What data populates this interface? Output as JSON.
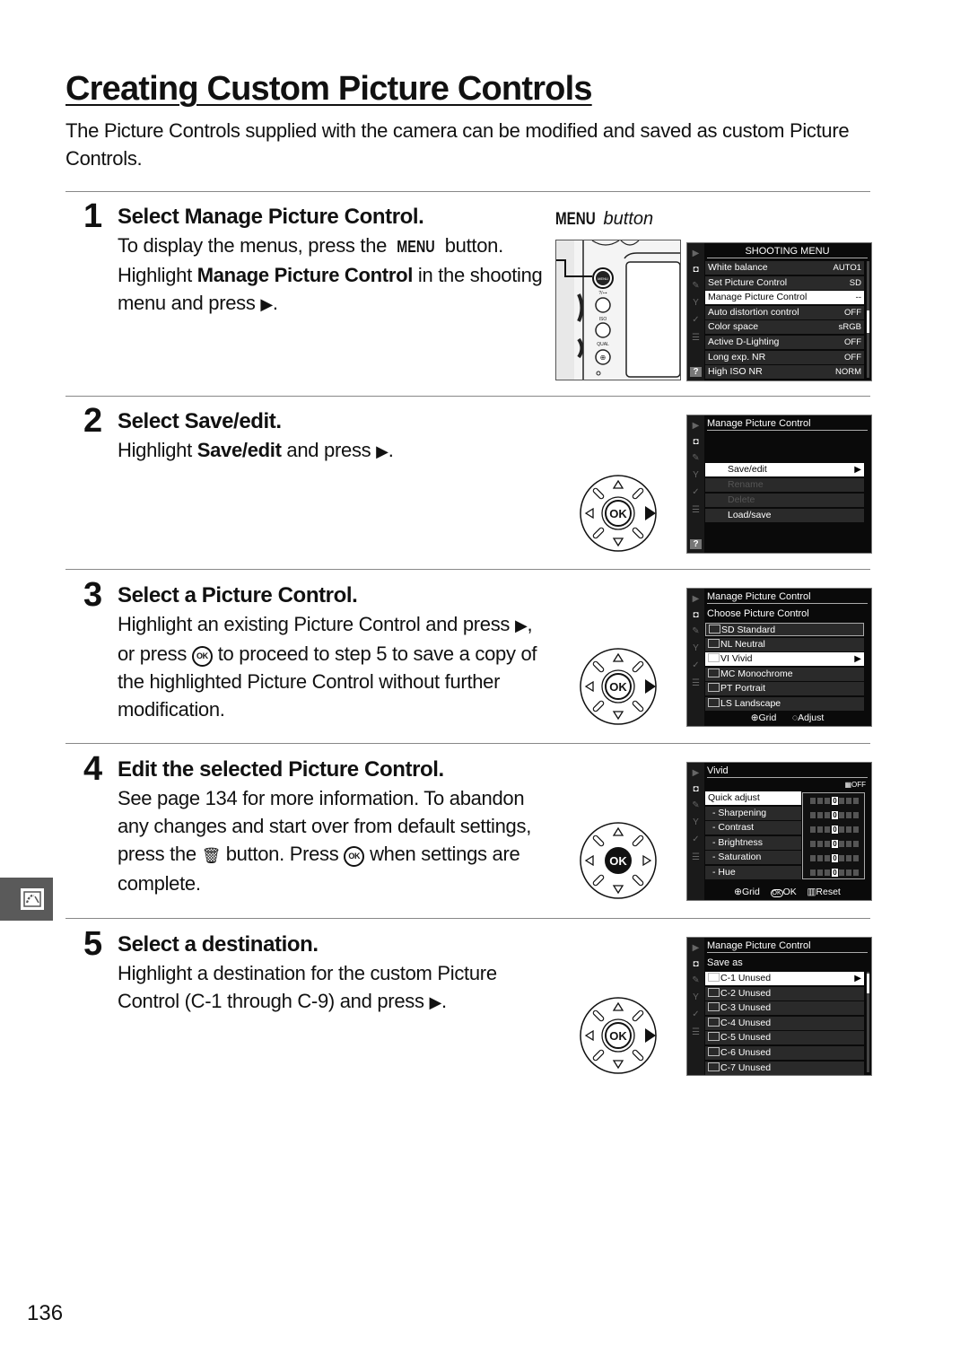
{
  "page": {
    "title": "Creating Custom Picture Controls",
    "intro": "The Picture Controls supplied with the camera can be modified and saved as custom Picture Controls.",
    "page_number": "136",
    "side_tab_icon": "picture-control-icon"
  },
  "step1": {
    "number": "1",
    "head_pre": "Select ",
    "head_bold": "Manage Picture Control",
    "head_post": ".",
    "line1_pre": "To display the menus, press the ",
    "line1_kw": "MENU",
    "line1_post": " button.",
    "line2_pre": "Highlight ",
    "line2_bold": "Manage Picture Control",
    "line2_post": " in the shooting menu and press",
    "line2_end": ".",
    "callout_kw": "MENU",
    "callout_text": " button",
    "camera_buttons": [
      "MENU",
      "?/o-n",
      "ISO",
      "QUAL"
    ],
    "screen": {
      "title": "SHOOTING MENU",
      "rows": [
        {
          "label": "White balance",
          "value": "AUTO1"
        },
        {
          "label": "Set Picture Control",
          "value": "SD"
        },
        {
          "label": "Manage Picture Control",
          "value": "--",
          "selected": true
        },
        {
          "label": "Auto distortion control",
          "value": "OFF"
        },
        {
          "label": "Color space",
          "value": "sRGB"
        },
        {
          "label": "Active D-Lighting",
          "value": "OFF"
        },
        {
          "label": "Long exp. NR",
          "value": "OFF"
        },
        {
          "label": "High ISO NR",
          "value": "NORM"
        }
      ]
    }
  },
  "step2": {
    "number": "2",
    "head_pre": "Select ",
    "head_bold": "Save/edit",
    "head_post": ".",
    "body_pre": "Highlight ",
    "body_bold": "Save/edit",
    "body_post": " and press",
    "body_end": ".",
    "screen": {
      "title": "Manage Picture Control",
      "rows": [
        {
          "label": "Save/edit",
          "state": "selected"
        },
        {
          "label": "Rename",
          "state": "disabled"
        },
        {
          "label": "Delete",
          "state": "disabled"
        },
        {
          "label": "Load/save",
          "state": "normal"
        }
      ]
    }
  },
  "step3": {
    "number": "3",
    "head": "Select a Picture Control.",
    "body_pre": "Highlight an existing Picture Control and press",
    "body_mid": ", or press",
    "body_post": " to proceed to step 5 to save a copy of the highlighted Picture Control without further modification.",
    "screen": {
      "title": "Manage Picture Control",
      "subtitle": "Choose Picture Control",
      "rows": [
        {
          "code": "SD",
          "label": "Standard"
        },
        {
          "code": "NL",
          "label": "Neutral"
        },
        {
          "code": "VI",
          "label": "Vivid",
          "selected": true
        },
        {
          "code": "MC",
          "label": "Monochrome"
        },
        {
          "code": "PT",
          "label": "Portrait"
        },
        {
          "code": "LS",
          "label": "Landscape"
        }
      ],
      "footer_grid": "Grid",
      "footer_adjust": "Adjust"
    }
  },
  "step4": {
    "number": "4",
    "head": "Edit the selected Picture Control.",
    "body_pre": "See page 134 for more information.  To abandon any changes and start over from default settings, press the",
    "body_mid": " button.  Press",
    "body_post": " when settings are complete.",
    "screen": {
      "title": "Vivid",
      "status": "OFF",
      "rows": [
        {
          "label": "Quick adjust",
          "value": 0,
          "selected": true
        },
        {
          "label": "Sharpening",
          "value": 0
        },
        {
          "label": "Contrast",
          "value": 0
        },
        {
          "label": "Brightness",
          "value": 0
        },
        {
          "label": "Saturation",
          "value": 0
        },
        {
          "label": "Hue",
          "value": 0
        }
      ],
      "footer": [
        "Grid",
        "OK",
        "Reset"
      ]
    }
  },
  "step5": {
    "number": "5",
    "head": "Select a destination.",
    "body_pre": "Highlight a destination for the custom Picture Control (C-1 through C-9) and press",
    "body_end": ".",
    "screen": {
      "title": "Manage Picture Control",
      "subtitle": "Save as",
      "rows": [
        {
          "code": "C-1",
          "label": "Unused",
          "selected": true
        },
        {
          "code": "C-2",
          "label": "Unused"
        },
        {
          "code": "C-3",
          "label": "Unused"
        },
        {
          "code": "C-4",
          "label": "Unused"
        },
        {
          "code": "C-5",
          "label": "Unused"
        },
        {
          "code": "C-6",
          "label": "Unused"
        },
        {
          "code": "C-7",
          "label": "Unused"
        }
      ]
    }
  },
  "glyphs": {
    "right": "▶",
    "ok": "OK",
    "trash": "🗑"
  },
  "dial": {
    "center": "OK"
  }
}
